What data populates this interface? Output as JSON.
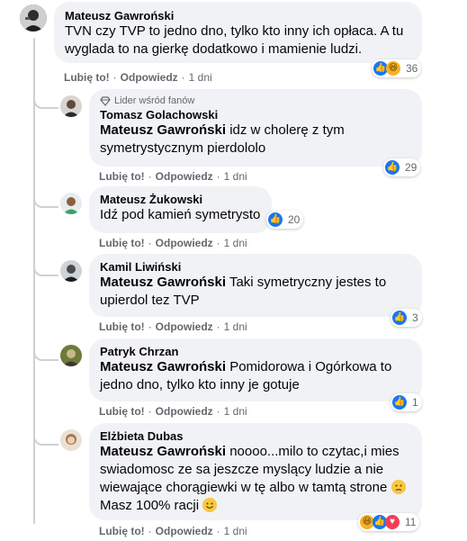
{
  "comments": [
    {
      "author": "Mateusz Gawroński",
      "text": "TVN czy TVP to jedno dno, tylko kto inny ich opłaca. A tu wygląda to na gierkę dodatkowo i mamienie ludzi.",
      "line1": "TVN czy TVP to jedno dno, tylko kto inny ich opłaca. A tu",
      "line2": "wyglada to na gierkę dodatkowo i mamienie ludzi.",
      "reaction_count": "36",
      "reactions": [
        "like-icon",
        "haha-icon"
      ]
    },
    {
      "badge": "Lider wśród fanów",
      "author": "Tomasz Golachowski",
      "mention": "Mateusz Gawroński",
      "line1": " idz w cholerę z tym",
      "line2": "symetrystycznym pierdololo",
      "reaction_count": "29",
      "reactions": [
        "like-icon"
      ]
    },
    {
      "author": "Mateusz Żukowski",
      "line1": "Idź pod kamień symetrysto",
      "reaction_count": "20",
      "reactions": [
        "like-icon"
      ]
    },
    {
      "author": "Kamil Liwiński",
      "mention": "Mateusz Gawroński",
      "line1": " Taki symetryczny jestes to",
      "line2": "upierdol tez TVP",
      "reaction_count": "3",
      "reactions": [
        "like-icon"
      ]
    },
    {
      "author": "Patryk Chrzan",
      "mention": "Mateusz Gawroński",
      "line1": " Pomidorowa i Ogórkowa to",
      "line2": "jedno dno, tylko kto inny je gotuje",
      "reaction_count": "1",
      "reactions": [
        "like-icon"
      ]
    },
    {
      "author": "Elżbieta Dubas",
      "mention": "Mateusz Gawroński",
      "line1": " noooo...milo to czytac,i mies",
      "line2": "swiadomosc ze sa jeszcze myslący ludzie a nie",
      "line3": "wiewające chorągiewki w tę albo w tamtą strone",
      "line4": "Masz 100% racji",
      "reaction_count": "11",
      "reactions": [
        "haha-icon",
        "like-icon",
        "love-icon"
      ]
    }
  ],
  "actions": {
    "like": "Lubię to!",
    "reply": "Odpowiedz",
    "time": "1 dni",
    "sep": "·"
  }
}
